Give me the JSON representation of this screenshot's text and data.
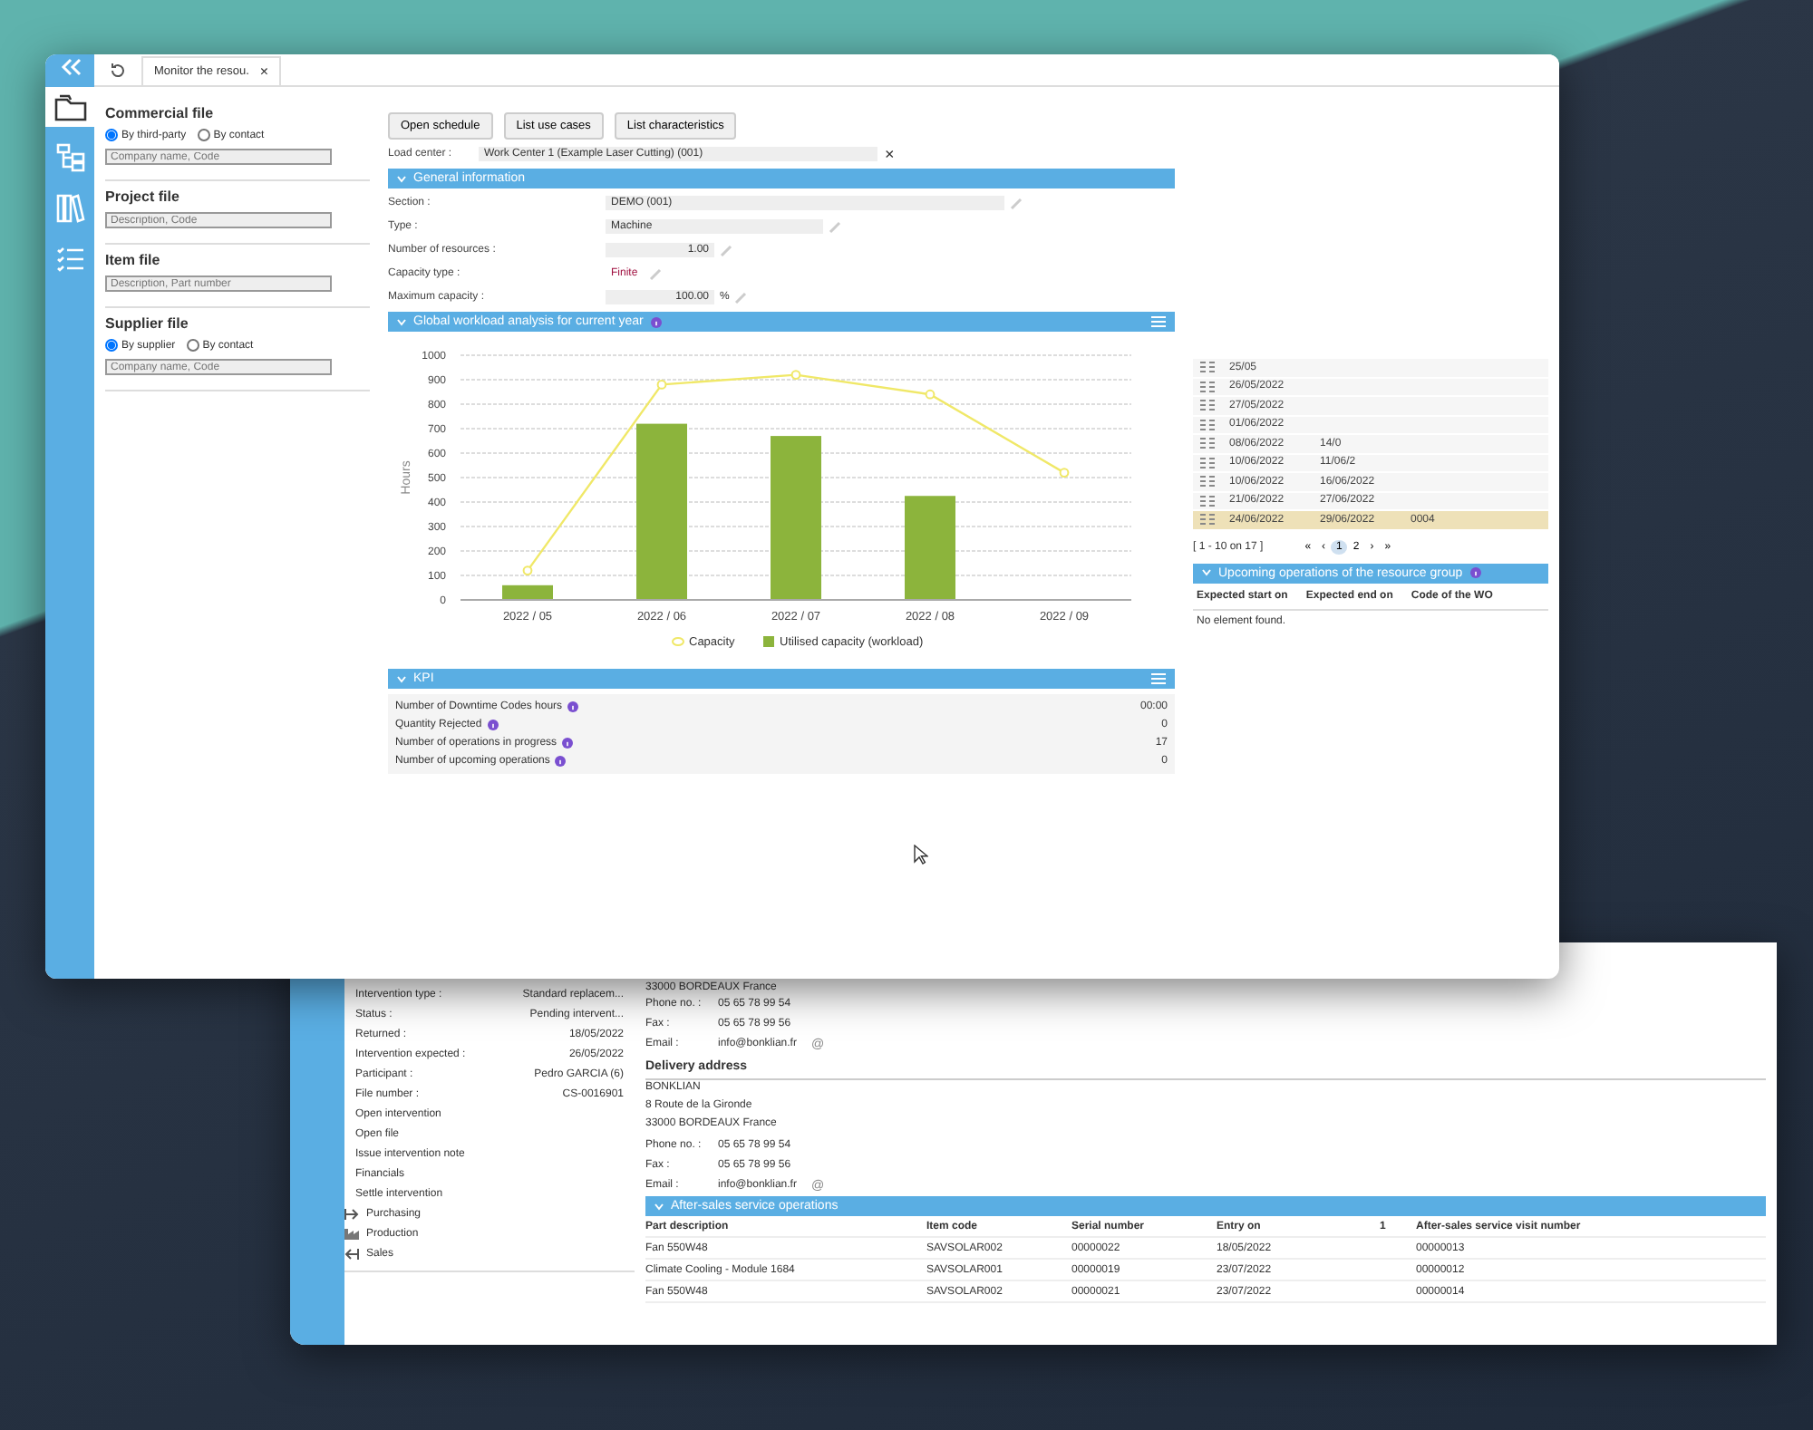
{
  "front": {
    "tab": {
      "title": "Monitor the resou.",
      "close": "×"
    },
    "side_icons": [
      {
        "kind": "folder",
        "selected": true
      },
      {
        "kind": "tree",
        "selected": false
      },
      {
        "kind": "books",
        "selected": false
      },
      {
        "kind": "checklist",
        "selected": false
      }
    ],
    "search_groups": [
      {
        "title": "Commercial file",
        "radios": [
          {
            "label": "By third-party",
            "selected": true
          },
          {
            "label": "By contact",
            "selected": false
          }
        ],
        "placeholder": "Company name, Code"
      },
      {
        "title": "Project file",
        "placeholder": "Description, Code"
      },
      {
        "title": "Item file",
        "placeholder": "Description, Part number"
      },
      {
        "title": "Supplier file",
        "radios": [
          {
            "label": "By supplier",
            "selected": true
          },
          {
            "label": "By contact",
            "selected": false
          }
        ],
        "placeholder": "Company name, Code"
      }
    ],
    "buttons": [
      "Open schedule",
      "List use cases",
      "List characteristics"
    ],
    "load_center": {
      "label": "Load center :",
      "value": "Work Center 1 (Example Laser Cutting) (001)",
      "clear": "×"
    },
    "general": {
      "title": "General information",
      "fields": [
        {
          "label": "Section :",
          "value": "DEMO (001)",
          "kind": "wide"
        },
        {
          "label": "Type :",
          "value": "Machine",
          "kind": "medium"
        },
        {
          "label": "Number of resources :",
          "value": "1.00",
          "kind": "number"
        },
        {
          "label": "Capacity type :",
          "value": "Finite",
          "kind": "link"
        },
        {
          "label": "Maximum capacity :",
          "value": "100.00",
          "unit": "%",
          "kind": "number"
        }
      ]
    },
    "workload": {
      "title": "Global workload analysis for current year",
      "chart_data": {
        "type": "bar",
        "ylabel": "Hours",
        "categories": [
          "2022 / 05",
          "2022 / 06",
          "2022 / 07",
          "2022 / 08",
          "2022 / 09"
        ],
        "series": [
          {
            "name": "Capacity",
            "color": "#f0e868",
            "type": "line",
            "marker": "circle",
            "values": [
              120,
              880,
              920,
              840,
              520
            ]
          },
          {
            "name": "Utilised capacity (workload)",
            "color": "#8cb43c",
            "values": [
              60,
              720,
              670,
              425,
              0
            ]
          }
        ],
        "grid": true,
        "legend": true,
        "ylim": [
          0,
          1000
        ],
        "yticks": [
          0,
          100,
          200,
          300,
          400,
          500,
          600,
          700,
          800,
          900,
          1000
        ]
      }
    },
    "kpi": {
      "title": "KPI",
      "rows": [
        {
          "label": "Number of Downtime Codes hours",
          "value": "00:00"
        },
        {
          "label": "Quantity Rejected",
          "value": "0"
        },
        {
          "label": "Number of operations in progress",
          "value": "17"
        },
        {
          "label": "Number of upcoming operations",
          "value": "0"
        }
      ]
    },
    "schedule": {
      "rows": [
        {
          "cells": [
            "25/05"
          ],
          "selected": false
        },
        {
          "cells": [
            "26/05/2022"
          ],
          "selected": false
        },
        {
          "cells": [
            "27/05/2022"
          ],
          "selected": false
        },
        {
          "cells": [
            "01/06/2022"
          ],
          "selected": false
        },
        {
          "cells": [
            "08/06/2022",
            "14/0"
          ],
          "selected": false
        },
        {
          "cells": [
            "10/06/2022",
            "11/06/2"
          ],
          "selected": false
        },
        {
          "cells": [
            "10/06/2022",
            "16/06/2022"
          ],
          "selected": false
        },
        {
          "cells": [
            "21/06/2022",
            "27/06/2022"
          ],
          "selected": false
        },
        {
          "cells": [
            "24/06/2022",
            "29/06/2022",
            "0004"
          ],
          "selected": true
        }
      ],
      "range": "[ 1 - 10 on 17 ]",
      "pager": [
        {
          "label": "«",
          "selected": false
        },
        {
          "label": "‹",
          "selected": false
        },
        {
          "label": "1",
          "selected": true
        },
        {
          "label": "2",
          "selected": false
        },
        {
          "label": "›",
          "selected": false
        },
        {
          "label": "»",
          "selected": false
        }
      ]
    },
    "upcoming": {
      "title": "Upcoming operations of the resource group",
      "columns": [
        "Expected start on",
        "Expected end on",
        "Code of the WO"
      ],
      "empty": "No element found."
    }
  },
  "back": {
    "details": [
      {
        "label": "Intervention type :",
        "value": "Standard replacem..."
      },
      {
        "label": "Status :",
        "value": "Pending intervent..."
      },
      {
        "label": "Returned :",
        "value": "18/05/2022"
      },
      {
        "label": "Intervention expected :",
        "value": "26/05/2022"
      },
      {
        "label": "Participant :",
        "value": "Pedro GARCIA (6)"
      },
      {
        "label": "File number :",
        "value": "CS-0016901"
      }
    ],
    "actions": [
      "Open intervention",
      "Open file",
      "Issue intervention note",
      "Financials",
      "Settle intervention"
    ],
    "nav": [
      {
        "kind": "arrow-right",
        "label": "Purchasing"
      },
      {
        "kind": "factory",
        "label": "Production"
      },
      {
        "kind": "arrow-left",
        "label": "Sales"
      }
    ],
    "billing": {
      "address": [
        "33000 BORDEAUX  France"
      ],
      "contacts": [
        {
          "label": "Phone no. :",
          "value": "05 65 78 99 54"
        },
        {
          "label": "Fax :",
          "value": "05 65 78 99 56"
        },
        {
          "label": "Email :",
          "value": "info@bonklian.fr",
          "at": "@"
        }
      ]
    },
    "delivery": {
      "title": "Delivery address",
      "address": [
        "BONKLIAN",
        "8 Route de la Gironde",
        "33000 BORDEAUX  France"
      ],
      "contacts": [
        {
          "label": "Phone no. :",
          "value": "05 65 78 99 54"
        },
        {
          "label": "Fax :",
          "value": "05 65 78 99 56"
        },
        {
          "label": "Email :",
          "value": "info@bonklian.fr",
          "at": "@"
        }
      ]
    },
    "operations": {
      "title": "After-sales service operations",
      "columns": [
        "Part description",
        "Item code",
        "Serial number",
        "Entry on",
        "1",
        "After-sales service visit number"
      ],
      "rows": [
        [
          "Fan 550W48",
          "SAVSOLAR002",
          "00000022",
          "18/05/2022",
          "00000013"
        ],
        [
          "Climate Cooling - Module 1684",
          "SAVSOLAR001",
          "00000019",
          "23/07/2022",
          "00000012"
        ],
        [
          "Fan 550W48",
          "SAVSOLAR002",
          "00000021",
          "23/07/2022",
          "00000014"
        ]
      ]
    }
  }
}
